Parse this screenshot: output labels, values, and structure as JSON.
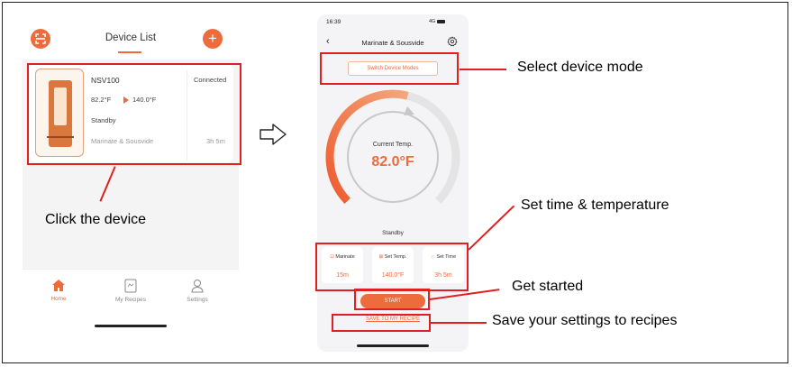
{
  "left_phone": {
    "title": "Device List",
    "device": {
      "name": "NSV100",
      "status": "Connected",
      "current_temp": "82.2°F",
      "target_temp": "140.0°F",
      "state": "Standby",
      "mode": "Marinate & Sousvide",
      "time": "3h 5m"
    },
    "tabs": [
      {
        "label": "Home"
      },
      {
        "label": "My Recipes"
      },
      {
        "label": "Settings"
      }
    ]
  },
  "right_phone": {
    "status_time": "16:39",
    "status_right": "4G",
    "nav_title": "Marinate & Sousvide",
    "mode_button": "Switch Device Modes",
    "current_label": "Current Temp.",
    "current_temp": "82.0°F",
    "state": "Standby",
    "settings": [
      {
        "label": "Marinate",
        "value": "15m"
      },
      {
        "label": "Set Temp.",
        "value": "140.0°F"
      },
      {
        "label": "Set Time",
        "value": "3h 5m"
      }
    ],
    "start_button": "START",
    "save_link": "SAVE TO MY RECIPE"
  },
  "annotations": {
    "click_device": "Click the device",
    "select_mode": "Select device mode",
    "set_time_temp": "Set time & temperature",
    "get_started": "Get started",
    "save_settings": "Save your settings to recipes"
  },
  "colors": {
    "accent": "#ee6b3b",
    "highlight": "#e02020"
  }
}
